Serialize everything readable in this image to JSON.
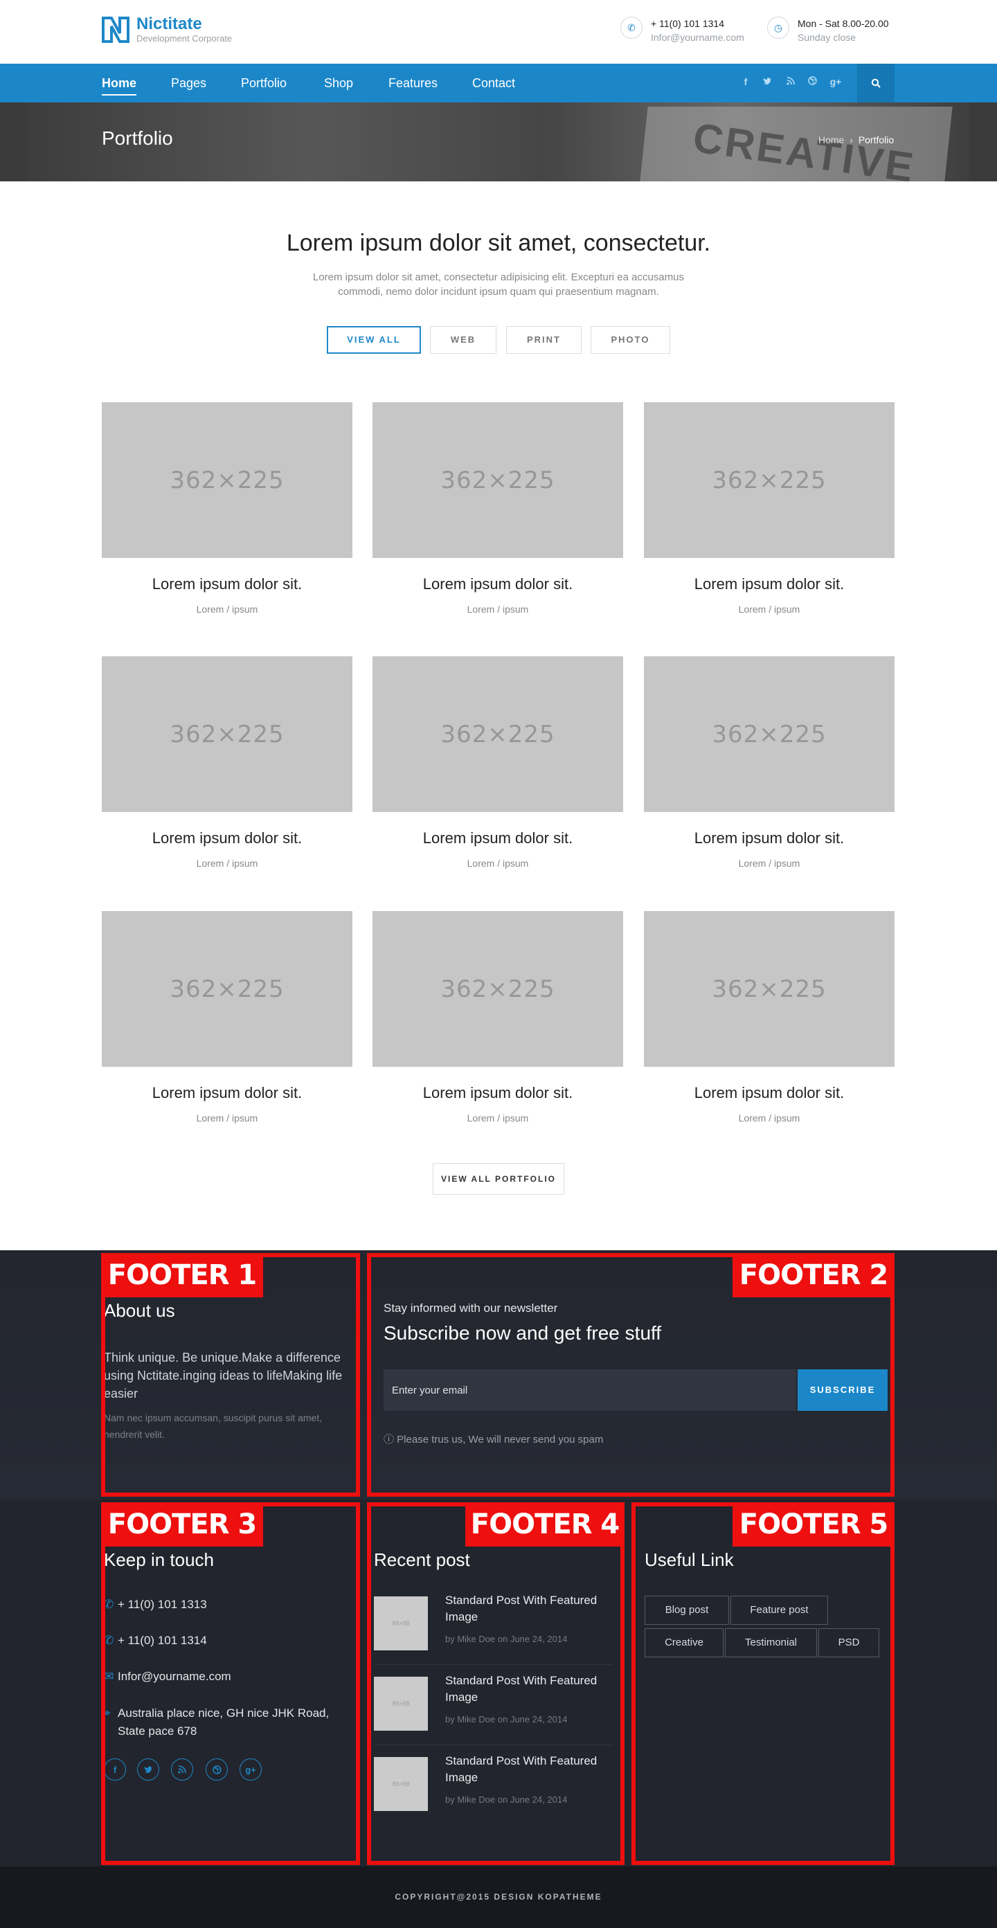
{
  "brand": {
    "name": "Nictitate",
    "tagline": "Development Corporate"
  },
  "contact_top": [
    {
      "icon": "phone-icon",
      "line1": "+ 11(0) 101 1314",
      "line2": "Infor@yourname.com"
    },
    {
      "icon": "clock-icon",
      "line1": "Mon - Sat 8.00-20.00",
      "line2": "Sunday close"
    }
  ],
  "nav": {
    "items": [
      "Home",
      "Pages",
      "Portfolio",
      "Shop",
      "Features",
      "Contact"
    ],
    "active": "Home"
  },
  "social_icons": [
    "facebook-icon",
    "twitter-icon",
    "rss-icon",
    "dribbble-icon",
    "google-plus-icon"
  ],
  "hero": {
    "title": "Portfolio",
    "hero_word": "CREATIVE",
    "breadcrumb_home": "Home",
    "breadcrumb_sep": "›",
    "breadcrumb_current": "Portfolio"
  },
  "intro": {
    "title": "Lorem ipsum dolor sit amet, consectetur.",
    "text": "Lorem ipsum dolor sit amet, consectetur adipisicing elit. Excepturi ea accusamus commodi, nemo dolor incidunt ipsum quam qui praesentium magnam."
  },
  "filters": [
    "VIEW ALL",
    "WEB",
    "PRINT",
    "PHOTO"
  ],
  "portfolio": {
    "placeholder": "362×225",
    "items": [
      {
        "title": "Lorem ipsum dolor sit.",
        "sub": "Lorem / ipsum"
      },
      {
        "title": "Lorem ipsum dolor sit.",
        "sub": "Lorem / ipsum"
      },
      {
        "title": "Lorem ipsum dolor sit.",
        "sub": "Lorem / ipsum"
      },
      {
        "title": "Lorem ipsum dolor sit.",
        "sub": "Lorem / ipsum"
      },
      {
        "title": "Lorem ipsum dolor sit.",
        "sub": "Lorem / ipsum"
      },
      {
        "title": "Lorem ipsum dolor sit.",
        "sub": "Lorem / ipsum"
      },
      {
        "title": "Lorem ipsum dolor sit.",
        "sub": "Lorem / ipsum"
      },
      {
        "title": "Lorem ipsum dolor sit.",
        "sub": "Lorem / ipsum"
      },
      {
        "title": "Lorem ipsum dolor sit.",
        "sub": "Lorem / ipsum"
      }
    ],
    "view_all": "VIEW ALL PORTFOLIO"
  },
  "footer_labels": [
    "FOOTER 1",
    "FOOTER 2",
    "FOOTER 3",
    "FOOTER 4",
    "FOOTER 5"
  ],
  "about": {
    "heading": "About us",
    "text": "Think unique. Be unique.Make a difference using Nctitate.inging ideas to lifeMaking life easier",
    "muted": "Nam nec ipsum accumsan, suscipit purus sit amet, hendrerit velit."
  },
  "newsletter": {
    "small": "Stay informed with our newsletter",
    "big": "Subscribe now and get free stuff",
    "placeholder": "Enter your email",
    "button": "SUBSCRIBE",
    "note": "Please trus us, We will never send you spam"
  },
  "keep_in_touch": {
    "heading": "Keep in touch",
    "phone1": "+ 11(0) 101 1313",
    "phone2": "+ 11(0) 101 1314",
    "email": "Infor@yourname.com",
    "address": "Australia place nice, GH nice JHK Road, State pace 678"
  },
  "recent_posts": {
    "heading": "Recent post",
    "thumb": "88×88",
    "posts": [
      {
        "title": "Standard Post With Featured Image",
        "meta": "by Mike Doe on June 24, 2014"
      },
      {
        "title": "Standard Post With Featured Image",
        "meta": "by Mike Doe on June 24, 2014"
      },
      {
        "title": "Standard Post With Featured Image",
        "meta": "by Mike Doe on June 24, 2014"
      }
    ]
  },
  "useful_links": {
    "heading": "Useful Link",
    "tags": [
      "Blog post",
      "Feature post",
      "Creative",
      "Testimonial",
      "PSD"
    ]
  },
  "copyright": "COPYRIGHT@2015 DESIGN KOPATHEME",
  "colors": {
    "accent": "#1b87c9",
    "footer_bg": "#22252d",
    "annotation_red": "#ee0f0f"
  }
}
